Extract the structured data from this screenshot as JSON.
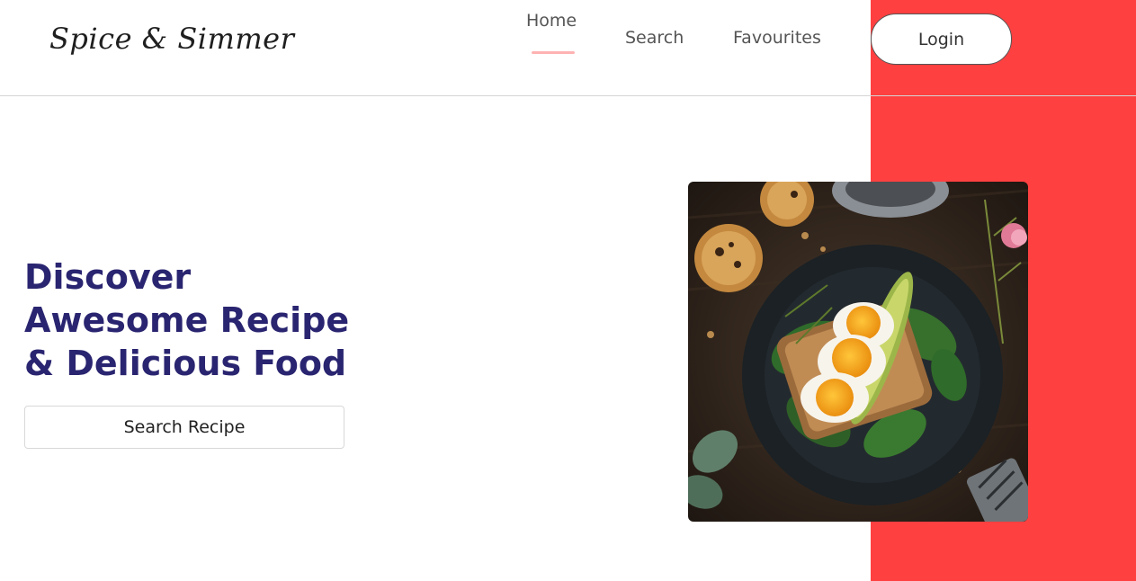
{
  "brand": {
    "logo_text": "Spice & Simmer"
  },
  "nav": {
    "home": "Home",
    "search": "Search",
    "favourites": "Favourites",
    "login": "Login",
    "active": "home"
  },
  "hero": {
    "title_lines": [
      "Discover",
      "Awesome Recipe",
      "& Delicious Food"
    ],
    "cta_label": "Search Recipe"
  },
  "colors": {
    "accent": "#ff4040",
    "title": "#2a2570",
    "nav_text": "#555555",
    "active_underline": "#ffb3b3"
  },
  "icons": {
    "hero_image": "food-photo-eggs-avocado-toast"
  }
}
